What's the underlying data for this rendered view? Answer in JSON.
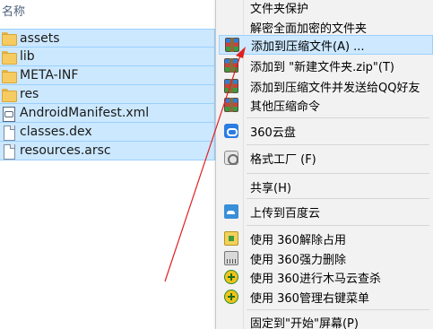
{
  "explorer": {
    "column_header": "名称",
    "files": [
      {
        "name": "assets",
        "icon": "folder-icon"
      },
      {
        "name": "lib",
        "icon": "folder-icon"
      },
      {
        "name": "META-INF",
        "icon": "folder-icon"
      },
      {
        "name": "res",
        "icon": "folder-icon"
      },
      {
        "name": "AndroidManifest.xml",
        "icon": "xml-file-icon"
      },
      {
        "name": "classes.dex",
        "icon": "file-icon"
      },
      {
        "name": "resources.arsc",
        "icon": "file-icon"
      }
    ]
  },
  "context_menu": {
    "items": [
      {
        "label": "文件夹保护"
      },
      {
        "label": "解密全面加密的文件夹"
      },
      {
        "label": "添加到压缩文件(A) ...",
        "icon": "winrar-icon",
        "highlighted": true
      },
      {
        "label": "添加到 \"新建文件夹.zip\"(T)",
        "icon": "winrar-icon"
      },
      {
        "label": "添加到压缩文件并发送给QQ好友",
        "icon": "winrar-icon"
      },
      {
        "label": "其他压缩命令",
        "icon": "winrar-icon"
      },
      {
        "label": "360云盘",
        "icon": "cloud-icon"
      },
      {
        "label": "格式工厂 (F)",
        "icon": "format-factory-icon"
      },
      {
        "label": "共享(H)"
      },
      {
        "label": "上传到百度云",
        "icon": "baidu-cloud-icon"
      },
      {
        "label": "使用 360解除占用",
        "icon": "unlock-icon"
      },
      {
        "label": "使用 360强力删除",
        "icon": "shredder-icon"
      },
      {
        "label": "使用 360进行木马云查杀",
        "icon": "shield-plus-icon"
      },
      {
        "label": "使用 360管理右键菜单",
        "icon": "shield-plus-icon"
      },
      {
        "label": "固定到\"开始\"屏幕(P)"
      }
    ]
  },
  "colors": {
    "selection_fill": "#cce8ff",
    "selection_border": "#99d1ff",
    "menu_background": "#f2f2f2",
    "arrow": "#e02020"
  }
}
